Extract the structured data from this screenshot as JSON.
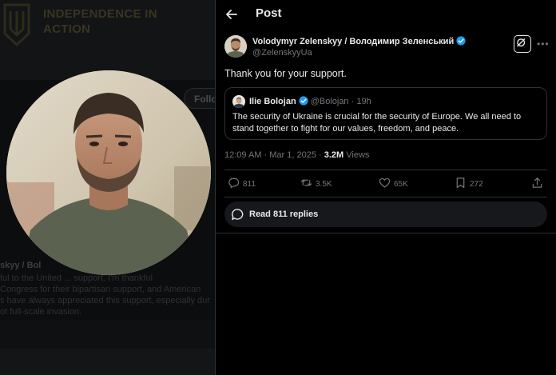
{
  "background_profile": {
    "banner_text": "INDEPENDENCE IN ACTION",
    "follow_label": "Follo",
    "name_fragment": "skyy / Bol",
    "text_lines": [
      "ful to the United ... support. I'm thankful",
      "Congress for their bipartisan support, and American",
      "s have always appreciated this support, especially dur",
      "ot full-scale invasion."
    ]
  },
  "header": {
    "title": "Post",
    "back_icon": "arrow-left-icon"
  },
  "post": {
    "author_name": "Volodymyr Zelenskyy / Володимир Зеленський",
    "author_handle": "@ZelenskyyUa",
    "text": "Thank you for your support.",
    "timestamp": "12:09 AM · Mar 1, 2025 · ",
    "views_count": "3.2M",
    "views_label": " Views",
    "quote": {
      "author_name": "Ilie Bolojan",
      "author_handle": "@Bolojan · 19h",
      "text": "The security of Ukraine is crucial for the security of Europe. We all need to stand together to fight for our values, freedom, and peace."
    },
    "actions": {
      "replies": "811",
      "reposts": "3.5K",
      "likes": "65K",
      "bookmarks": "272"
    },
    "read_replies_label": "Read 811 replies",
    "more_icon": "ellipsis-icon",
    "grok_icon": "grok-icon"
  },
  "colors": {
    "background": "#000000",
    "text_primary": "#e7e9ea",
    "text_secondary": "#71767b",
    "border": "#2f3336",
    "verified": "#1d9bf0"
  }
}
